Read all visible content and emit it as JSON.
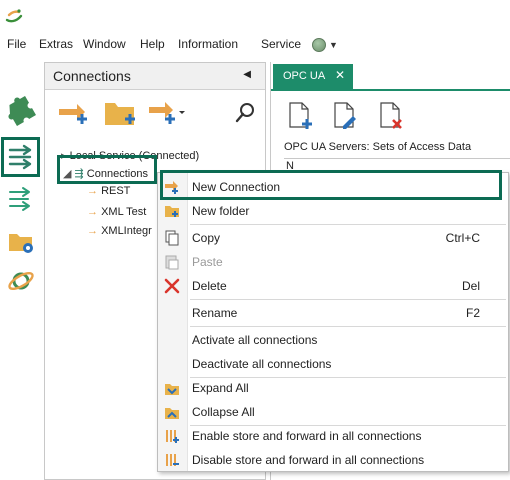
{
  "menubar": {
    "items": [
      "File",
      "Extras",
      "Window",
      "Help",
      "Information"
    ],
    "service_label": "Service",
    "service_status_color": "#6b8f6b"
  },
  "left_icons": [
    "puzzle-icon",
    "connections-icon",
    "routing-icon",
    "settings-folder-icon",
    "orbit-icon"
  ],
  "connections_panel": {
    "title": "Connections",
    "toolbar": [
      "new-connection-icon",
      "new-folder-icon",
      "add-dropdown-icon",
      "search-icon"
    ],
    "tree": {
      "root": "Local Service (Connected)",
      "group": "Connections",
      "children": [
        "REST",
        "XML Test",
        "XMLIntegr"
      ]
    }
  },
  "right_panel": {
    "tab_label": "OPC UA",
    "tab_close": "✕",
    "heading": "OPC UA Servers: Sets of Access Data",
    "grid_first_char": "N"
  },
  "context_menu": {
    "items": [
      {
        "label": "New Connection",
        "shortcut": "",
        "icon": "new-connection-icon",
        "disabled": false
      },
      {
        "label": "New folder",
        "shortcut": "",
        "icon": "new-folder-icon",
        "disabled": false
      },
      {
        "label": "Copy",
        "shortcut": "Ctrl+C",
        "icon": "copy-icon",
        "disabled": false
      },
      {
        "label": "Paste",
        "shortcut": "",
        "icon": "paste-icon",
        "disabled": true
      },
      {
        "label": "Delete",
        "shortcut": "Del",
        "icon": "delete-icon",
        "disabled": false
      },
      {
        "label": "Rename",
        "shortcut": "F2",
        "icon": "",
        "disabled": false
      },
      {
        "label": "Activate all connections",
        "shortcut": "",
        "icon": "",
        "disabled": false
      },
      {
        "label": "Deactivate all connections",
        "shortcut": "",
        "icon": "",
        "disabled": false
      },
      {
        "label": "Expand All",
        "shortcut": "",
        "icon": "expand-all-icon",
        "disabled": false
      },
      {
        "label": "Collapse All",
        "shortcut": "",
        "icon": "collapse-all-icon",
        "disabled": false
      },
      {
        "label": "Enable store and forward in all connections",
        "shortcut": "",
        "icon": "enable-store-forward-icon",
        "disabled": false
      },
      {
        "label": "Disable store and forward in all connections",
        "shortcut": "",
        "icon": "disable-store-forward-icon",
        "disabled": false
      }
    ]
  },
  "colors": {
    "accent": "#1d8c6a",
    "highlight": "#0c6b53",
    "arrow": "#e8a24a",
    "plus": "#2a6fb8",
    "delete": "#d9342b"
  }
}
